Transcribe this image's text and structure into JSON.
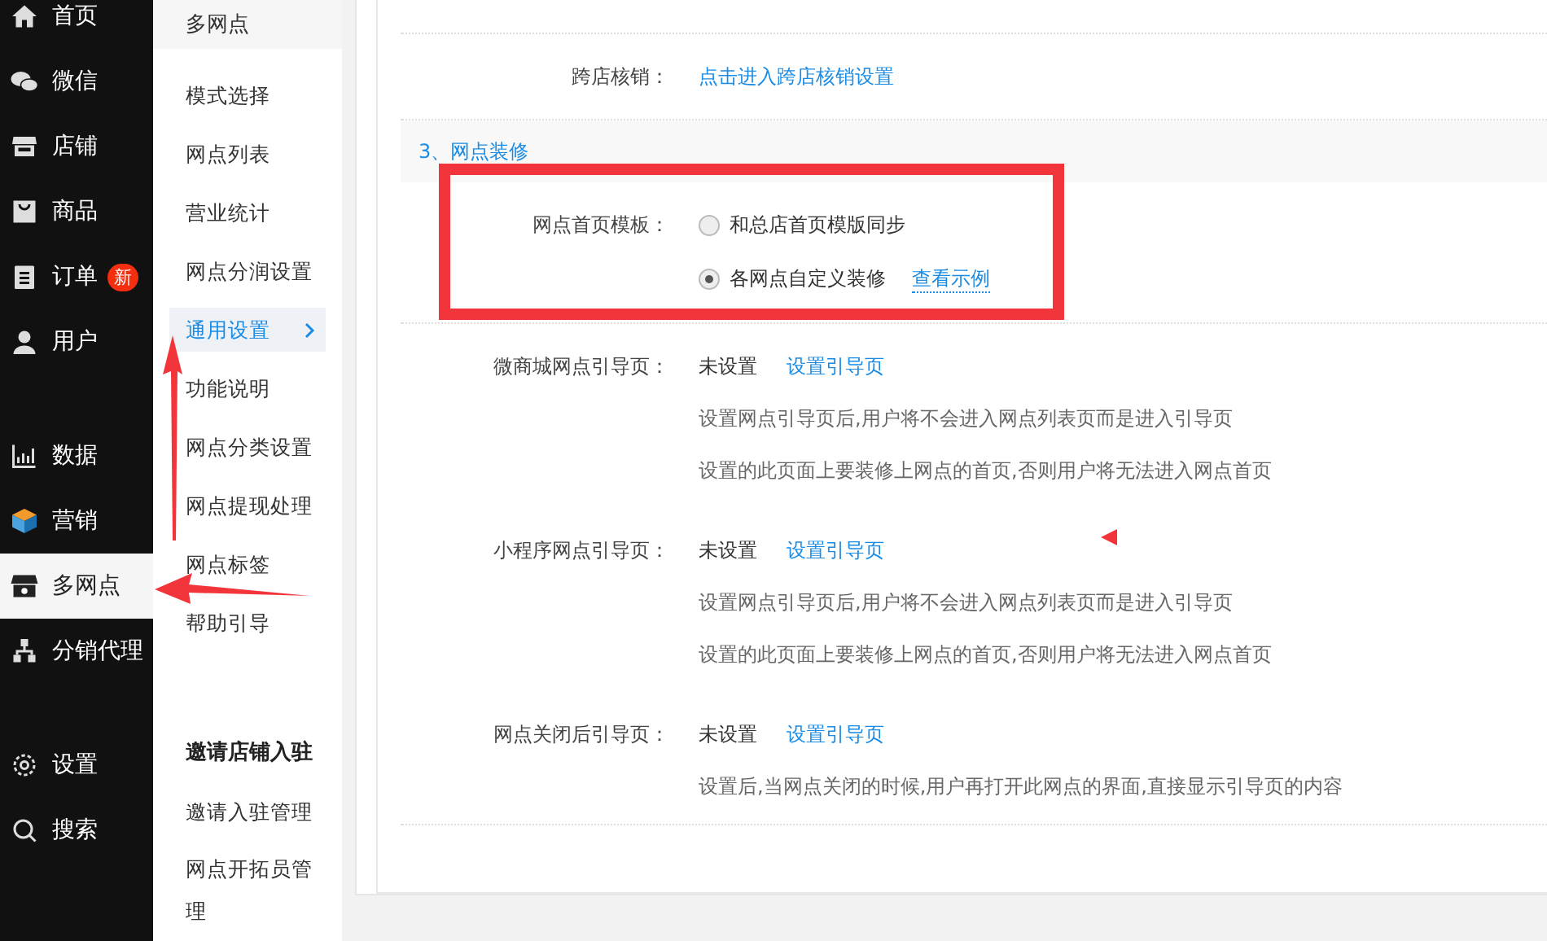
{
  "sidebar": {
    "groups": [
      {
        "items": [
          {
            "label": "首页",
            "selected": false
          },
          {
            "label": "微信",
            "selected": false
          },
          {
            "label": "店铺",
            "selected": false
          },
          {
            "label": "商品",
            "selected": false
          },
          {
            "label": "订单",
            "selected": false,
            "badge": "新"
          },
          {
            "label": "用户",
            "selected": false
          }
        ]
      },
      {
        "items": [
          {
            "label": "数据",
            "selected": false
          },
          {
            "label": "营销",
            "selected": false
          },
          {
            "label": "多网点",
            "selected": true
          },
          {
            "label": "分销代理",
            "selected": false
          }
        ]
      },
      {
        "items": [
          {
            "label": "设置",
            "selected": false
          },
          {
            "label": "搜索",
            "selected": false
          }
        ]
      }
    ]
  },
  "submenu": {
    "title": "多网点",
    "groups": [
      {
        "items": [
          {
            "label": "模式选择",
            "selected": false
          },
          {
            "label": "网点列表",
            "selected": false
          },
          {
            "label": "营业统计",
            "selected": false
          },
          {
            "label": "网点分润设置",
            "selected": false
          },
          {
            "label": "通用设置",
            "selected": true
          },
          {
            "label": "功能说明",
            "selected": false
          },
          {
            "label": "网点分类设置",
            "selected": false
          },
          {
            "label": "网点提现处理",
            "selected": false
          },
          {
            "label": "网点标签",
            "selected": false
          },
          {
            "label": "帮助引导",
            "selected": false
          }
        ]
      },
      {
        "heading": "邀请店铺入驻",
        "items": [
          {
            "label": "邀请入驻管理",
            "selected": false
          },
          {
            "label": "网点开拓员管理",
            "selected": false
          }
        ]
      }
    ]
  },
  "content": {
    "top_rows": [
      {
        "label": "跨店核销：",
        "link": "点击进入跨店核销设置"
      }
    ],
    "section": {
      "title": "3、网点装修",
      "template": {
        "label": "网点首页模板：",
        "options": [
          {
            "label": "和总店首页模版同步",
            "selected": false
          },
          {
            "label": "各网点自定义装修",
            "selected": true,
            "link": "查看示例"
          }
        ]
      },
      "rows": [
        {
          "label": "微商城网点引导页：",
          "status": "未设置",
          "link": "设置引导页",
          "notes": [
            "设置网点引导页后,用户将不会进入网点列表页而是进入引导页",
            "设置的此页面上要装修上网点的首页,否则用户将无法进入网点首页"
          ]
        },
        {
          "label": "小程序网点引导页：",
          "status": "未设置",
          "link": "设置引导页",
          "notes": [
            "设置网点引导页后,用户将不会进入网点列表页而是进入引导页",
            "设置的此页面上要装修上网点的首页,否则用户将无法进入网点首页"
          ]
        },
        {
          "label": "网点关闭后引导页：",
          "status": "未设置",
          "link": "设置引导页",
          "notes": [
            "设置后,当网点关闭的时候,用户再打开此网点的界面,直接显示引导页的内容"
          ]
        }
      ]
    }
  }
}
